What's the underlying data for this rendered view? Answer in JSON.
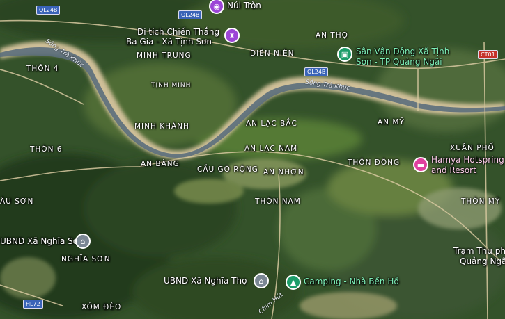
{
  "places": {
    "thon4": "THÔN 4",
    "minh_trung": "MINH TRUNG",
    "tinh_minh": "TỊNH MINH",
    "minh_khanh": "MINH KHÁNH",
    "dien_nien": "DIÊN NIÊN",
    "an_tho": "AN THỌ",
    "an_lac_bac": "AN LẠC BẮC",
    "an_lac_nam": "AN LẠC NAM",
    "an_my": "AN MỸ",
    "thon6": "THÔN 6",
    "an_bang": "AN BÀNG",
    "cau_go_rong": "CẦU GÒ RỘNG",
    "an_nhon": "AN NHƠN",
    "thon_dong": "THÔN ĐÔNG",
    "xuan_pho": "XUÂN PHỐ",
    "thon_my": "THÔN MỸ",
    "au_son": "ÂU SƠN",
    "thon_nam": "THÔN NAM",
    "nghia_son": "NGHĨA SƠN",
    "xom_deo": "XÓM ĐÈO"
  },
  "pois": {
    "nui_tron": "Núi Tròn",
    "di_tich_line1": "Di tích Chiến Thắng",
    "di_tich_line2": "Ba Gia - Xã Tịnh Sơn",
    "san_van_dong_line1": "Sân Vận Động Xã Tịnh",
    "san_van_dong_line2": "Sơn - TP Quảng Ngãi",
    "hamya_line1": "Hamya Hotspring",
    "hamya_line2": "and Resort",
    "ubnd_nghia_son": "UBND Xã Nghĩa Sơn",
    "ubnd_nghia_tho": "UBND Xã Nghĩa Thọ",
    "camping": "Camping - Nhà Bến Hồ",
    "tram_line1": "Trạm Thu ph",
    "tram_line2": "Quảng Ngã"
  },
  "roads": {
    "ql24b_a": "QL24B",
    "ql24b_b": "QL24B",
    "ql24b_c": "QL24B",
    "ct01": "CT01",
    "hl72": "HL72",
    "chim_hut": "Chim Hút"
  },
  "river": {
    "song_tra_khuc_a": "Sông Trà Khúc",
    "song_tra_khuc_b": "Sông Trà Khúc"
  },
  "colors": {
    "water": "#5b6e7c",
    "sand": "#cdbb93",
    "forest": "#2a4420",
    "farmland": "#5f7a3a",
    "poi_green": "#1e9d6a",
    "poi_purple": "#9c45d6",
    "poi_pink": "#e0409e",
    "road_shield_blue": "#3a64b8",
    "road_shield_red": "#c5312b"
  },
  "icons": {
    "nui_tron": "camera-icon",
    "di_tich": "monument-icon",
    "san_van_dong": "stadium-icon",
    "hamya": "hotel-bed-icon",
    "ubnd": "government-building-icon",
    "camping": "campground-icon"
  }
}
